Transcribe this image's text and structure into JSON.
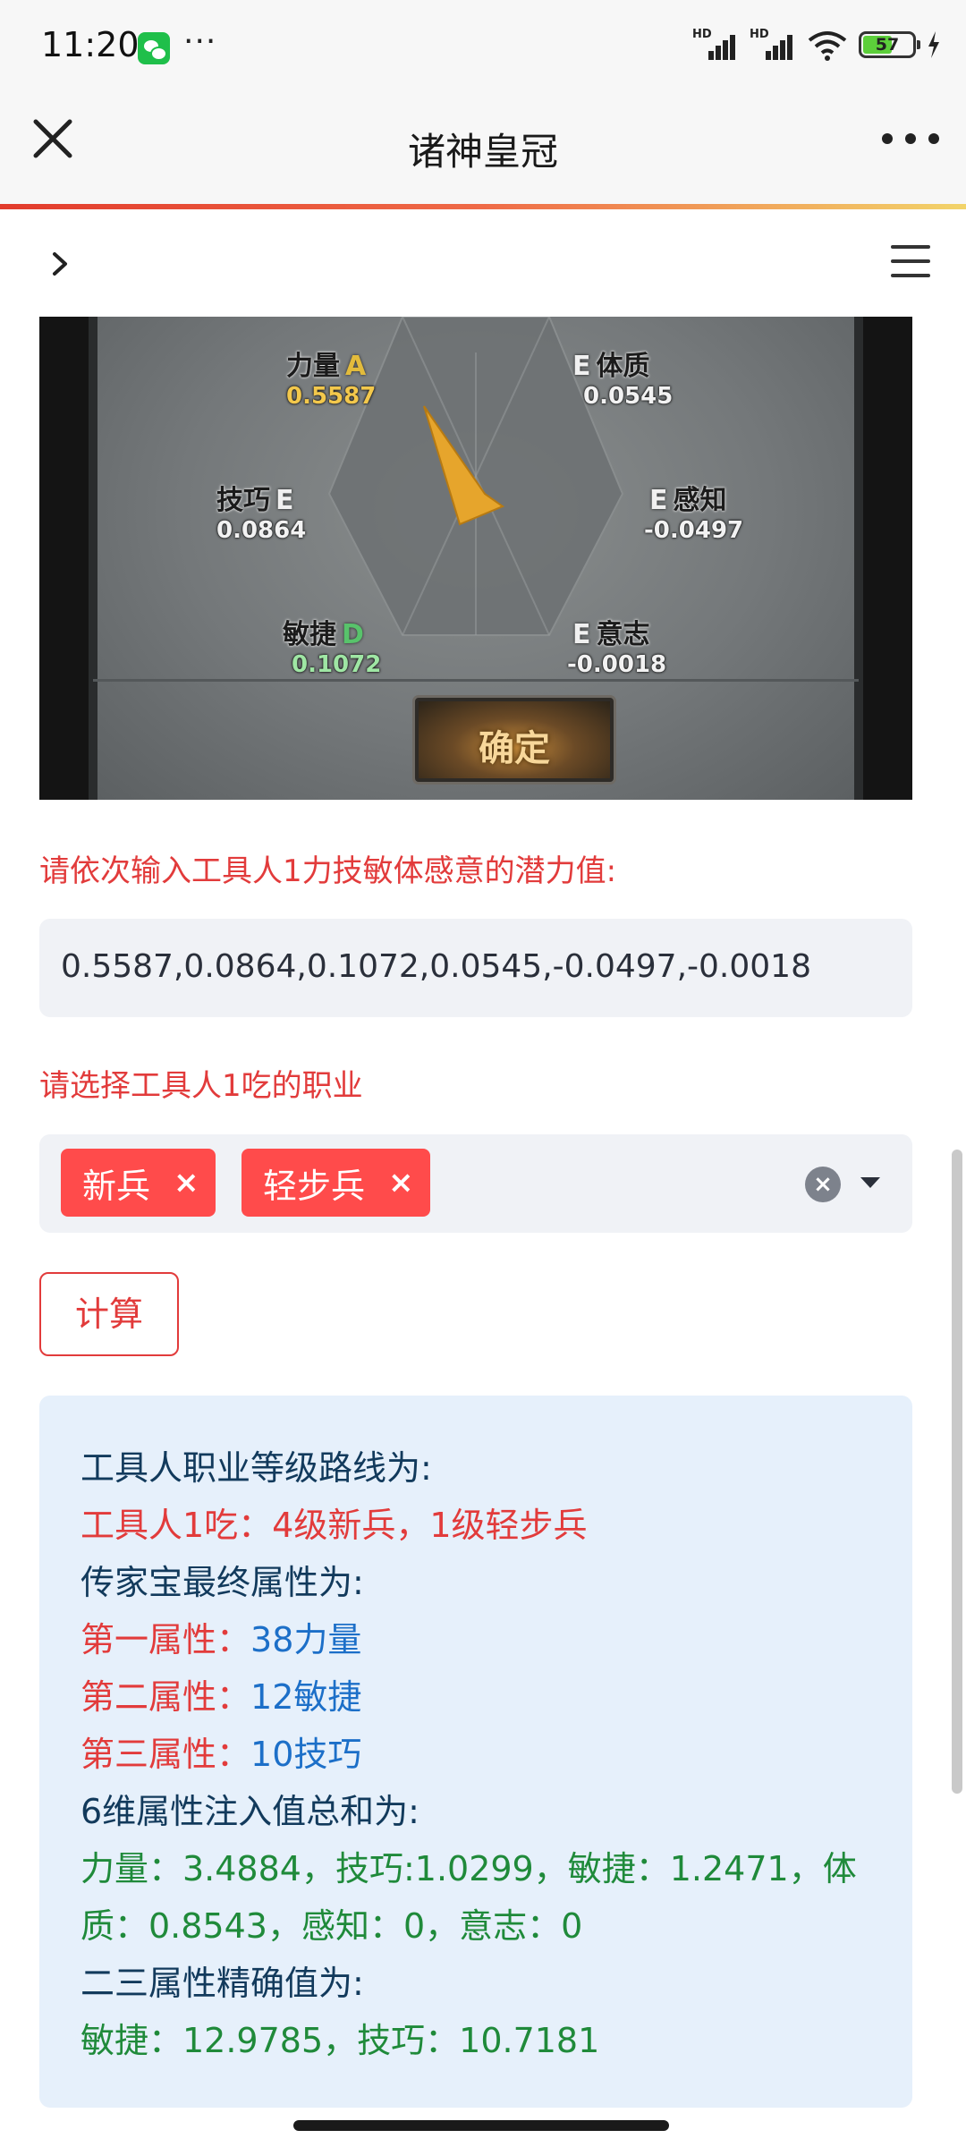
{
  "status_bar": {
    "time": "11:20",
    "more": "···",
    "battery": "57",
    "network_label": "HD"
  },
  "title_bar": {
    "title": "诸神皇冠"
  },
  "game": {
    "stats": {
      "str": {
        "name": "力量",
        "grade": "A",
        "value": "0.5587"
      },
      "con": {
        "name": "体质",
        "grade": "E",
        "value": "0.0545"
      },
      "skl": {
        "name": "技巧",
        "grade": "E",
        "value": "0.0864"
      },
      "per": {
        "name": "感知",
        "grade": "E",
        "value": "-0.0497"
      },
      "agi": {
        "name": "敏捷",
        "grade": "D",
        "value": "0.1072"
      },
      "wil": {
        "name": "意志",
        "grade": "E",
        "value": "-0.0018"
      }
    },
    "confirm_label": "确定"
  },
  "form": {
    "potential_label": "请依次输入工具人1力技敏体感意的潜力值:",
    "potential_value": "0.5587,0.0864,0.1072,0.0545,-0.0497,-0.0018",
    "job_label": "请选择工具人1吃的职业",
    "selected_jobs": [
      "新兵",
      "轻步兵"
    ],
    "chip_remove": "×",
    "clear_all": "×",
    "calc_label": "计算"
  },
  "result": {
    "route_title": "工具人职业等级路线为:",
    "route_line": "工具人1吃：4级新兵，1级轻步兵",
    "heirloom_title": "传家宝最终属性为:",
    "attr1_label": "第一属性：",
    "attr1_value": "38力量",
    "attr2_label": "第二属性：",
    "attr2_value": "12敏捷",
    "attr3_label": "第三属性：",
    "attr3_value": "10技巧",
    "sum_title": "6维属性注入值总和为:",
    "sum_line1": "力量：3.4884，技巧:1.0299，敏捷：1.2471，体",
    "sum_line2": "质：0.8543，感知：0，意志：0",
    "exact_title": "二三属性精确值为:",
    "exact_line": "敏捷：12.9785，技巧：10.7181"
  }
}
